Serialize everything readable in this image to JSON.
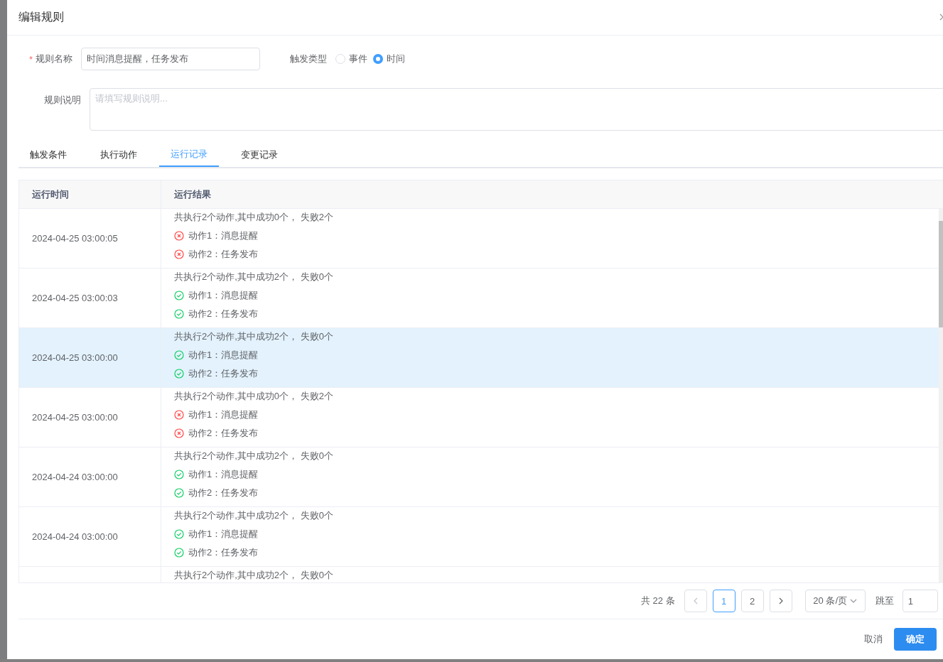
{
  "dialog": {
    "title": "编辑规则"
  },
  "form": {
    "name_label": "规则名称",
    "required_mark": "*",
    "name_value": "时间消息提醒，任务发布",
    "trigger_label": "触发类型",
    "trigger_options": [
      {
        "label": "事件",
        "selected": false
      },
      {
        "label": "时间",
        "selected": true
      }
    ],
    "desc_label": "规则说明",
    "desc_placeholder": "请填写规则说明..."
  },
  "tabs": [
    {
      "label": "触发条件",
      "selected": false
    },
    {
      "label": "执行动作",
      "selected": false
    },
    {
      "label": "运行记录",
      "selected": true
    },
    {
      "label": "变更记录",
      "selected": false
    }
  ],
  "table": {
    "columns": [
      "运行时间",
      "运行结果"
    ],
    "rows": [
      {
        "time": "2024-04-25 03:00:05",
        "summary": "共执行2个动作,其中成功0个， 失败2个",
        "selected": false,
        "actions": [
          {
            "label": "动作1：消息提醒",
            "success": false
          },
          {
            "label": "动作2：任务发布",
            "success": false
          }
        ]
      },
      {
        "time": "2024-04-25 03:00:03",
        "summary": "共执行2个动作,其中成功2个， 失败0个",
        "selected": false,
        "actions": [
          {
            "label": "动作1：消息提醒",
            "success": true
          },
          {
            "label": "动作2：任务发布",
            "success": true
          }
        ]
      },
      {
        "time": "2024-04-25 03:00:00",
        "summary": "共执行2个动作,其中成功2个， 失败0个",
        "selected": true,
        "actions": [
          {
            "label": "动作1：消息提醒",
            "success": true
          },
          {
            "label": "动作2：任务发布",
            "success": true
          }
        ]
      },
      {
        "time": "2024-04-25 03:00:00",
        "summary": "共执行2个动作,其中成功0个， 失败2个",
        "selected": false,
        "actions": [
          {
            "label": "动作1：消息提醒",
            "success": false
          },
          {
            "label": "动作2：任务发布",
            "success": false
          }
        ]
      },
      {
        "time": "2024-04-24 03:00:00",
        "summary": "共执行2个动作,其中成功2个， 失败0个",
        "selected": false,
        "actions": [
          {
            "label": "动作1：消息提醒",
            "success": true
          },
          {
            "label": "动作2：任务发布",
            "success": true
          }
        ]
      },
      {
        "time": "2024-04-24 03:00:00",
        "summary": "共执行2个动作,其中成功2个， 失败0个",
        "selected": false,
        "actions": [
          {
            "label": "动作1：消息提醒",
            "success": true
          },
          {
            "label": "动作2：任务发布",
            "success": true
          }
        ]
      },
      {
        "summary": "共执行2个动作,其中成功2个， 失败0个",
        "selected": false,
        "actions": []
      }
    ]
  },
  "pagination": {
    "total": "共 22 条",
    "pages": [
      {
        "label": "1",
        "selected": true
      },
      {
        "label": "2",
        "selected": false
      }
    ],
    "page_size": "20 条/页",
    "jump_label": "跳至",
    "jump_value": "1"
  },
  "footer": {
    "cancel": "取消",
    "confirm": "确定"
  }
}
